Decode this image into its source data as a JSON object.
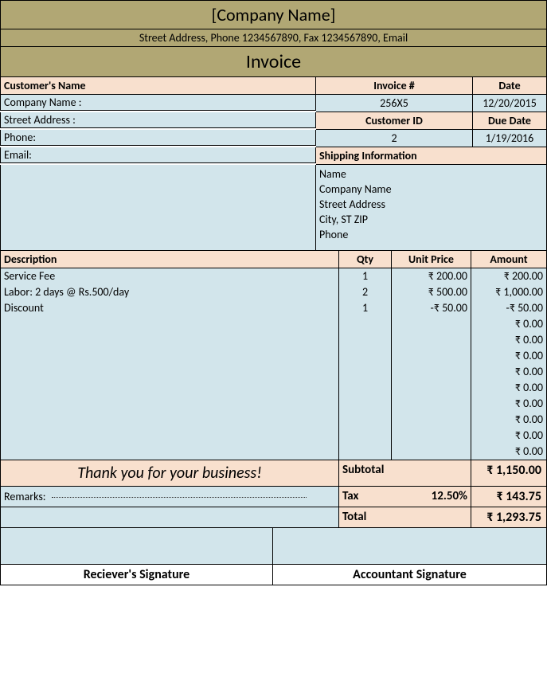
{
  "header": {
    "company_name": "[Company Name]",
    "company_info": "Street Address, Phone 1234567890, Fax 1234567890, Email",
    "invoice_title": "Invoice"
  },
  "customer": {
    "title": "Customer's Name",
    "company_label": "Company Name :",
    "street_label": "Street Address :",
    "phone_label": "Phone:",
    "email_label": "Email:"
  },
  "invoice_meta": {
    "invoice_num_label": "Invoice #",
    "invoice_num": "256X5",
    "date_label": "Date",
    "date": "12/20/2015",
    "customer_id_label": "Customer ID",
    "customer_id": "2",
    "due_date_label": "Due Date",
    "due_date": "1/19/2016"
  },
  "shipping": {
    "title": "Shipping Information",
    "name": "Name",
    "company": "Company Name",
    "street": "Street Address",
    "city": "City, ST ZIP",
    "phone": "Phone"
  },
  "columns": {
    "description": "Description",
    "qty": "Qty",
    "unit_price": "Unit Price",
    "amount": "Amount"
  },
  "items": [
    {
      "desc": "Service Fee",
      "qty": "1",
      "price": "₹ 200.00",
      "amount": "₹ 200.00"
    },
    {
      "desc": "Labor: 2 days @ Rs.500/day",
      "qty": "2",
      "price": "₹ 500.00",
      "amount": "₹ 1,000.00"
    },
    {
      "desc": "Discount",
      "qty": "1",
      "price": "-₹ 50.00",
      "amount": "-₹ 50.00"
    },
    {
      "desc": "",
      "qty": "",
      "price": "",
      "amount": "₹ 0.00"
    },
    {
      "desc": "",
      "qty": "",
      "price": "",
      "amount": "₹ 0.00"
    },
    {
      "desc": "",
      "qty": "",
      "price": "",
      "amount": "₹ 0.00"
    },
    {
      "desc": "",
      "qty": "",
      "price": "",
      "amount": "₹ 0.00"
    },
    {
      "desc": "",
      "qty": "",
      "price": "",
      "amount": "₹ 0.00"
    },
    {
      "desc": "",
      "qty": "",
      "price": "",
      "amount": "₹ 0.00"
    },
    {
      "desc": "",
      "qty": "",
      "price": "",
      "amount": "₹ 0.00"
    },
    {
      "desc": "",
      "qty": "",
      "price": "",
      "amount": "₹ 0.00"
    },
    {
      "desc": "",
      "qty": "",
      "price": "",
      "amount": "₹ 0.00"
    }
  ],
  "footer": {
    "thanks": "Thank you for your business!",
    "remarks_label": "Remarks:",
    "subtotal_label": "Subtotal",
    "subtotal": "₹ 1,150.00",
    "tax_label": "Tax",
    "tax_rate": "12.50%",
    "tax": "₹ 143.75",
    "total_label": "Total",
    "total": "₹ 1,293.75",
    "receiver_sig": "Reciever's Signature",
    "accountant_sig": "Accountant Signature"
  }
}
